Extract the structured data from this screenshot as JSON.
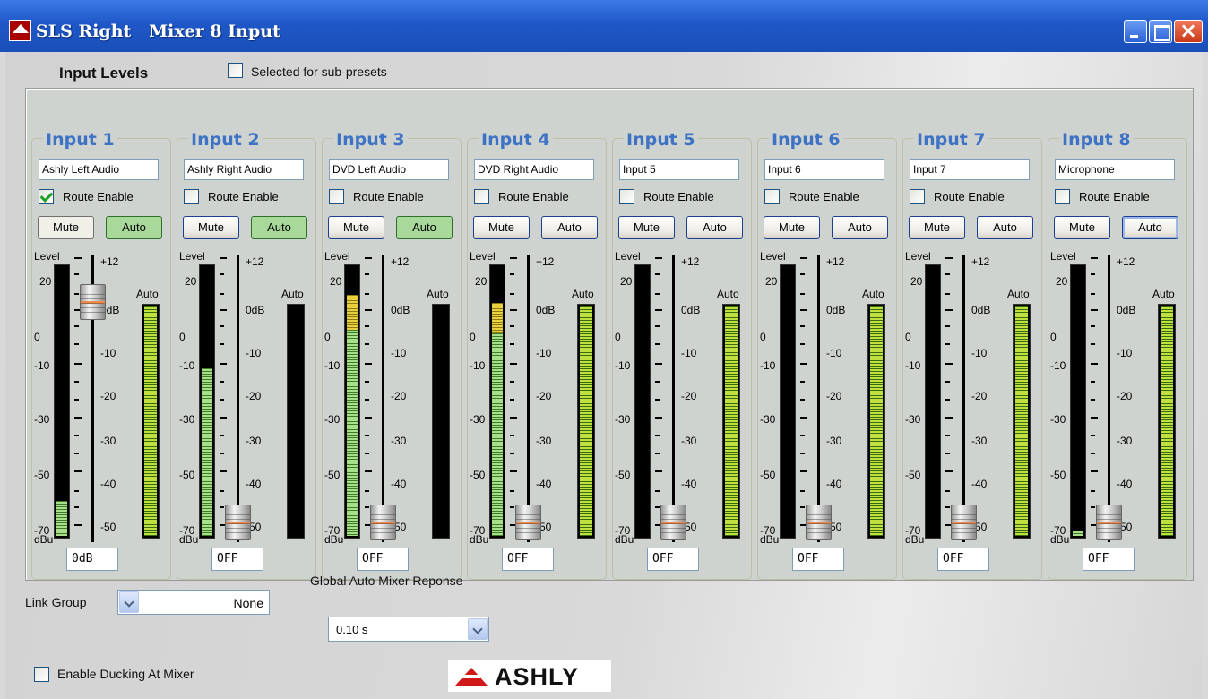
{
  "window": {
    "title": "SLS Right   Mixer 8 Input",
    "icon_text": "ASHLY"
  },
  "header": {
    "section_title": "Input Levels",
    "subpreset_label": "Selected for sub-presets",
    "subpreset_checked": false
  },
  "scale_labels": {
    "level": "Level",
    "dbu": "dBu",
    "meter": [
      "20",
      "0",
      "-10",
      "-30",
      "-50",
      "-70"
    ],
    "fader": [
      "+12",
      "0dB",
      "-10",
      "-20",
      "-30",
      "-40",
      "-50"
    ],
    "auto": "Auto"
  },
  "channels": [
    {
      "title": "Input 1",
      "name": "Ashly Left Audio",
      "route_label": "Route Enable",
      "route": true,
      "mute_label": "Mute",
      "auto_label": "Auto",
      "mute_on": true,
      "auto_on": true,
      "level_db": "0dB",
      "meter_fill": 0.13,
      "meter_yellow": 0,
      "fader_db": 0
    },
    {
      "title": "Input 2",
      "name": "Ashly Right Audio",
      "route_label": "Route Enable",
      "route": false,
      "mute_label": "Mute",
      "auto_label": "Auto",
      "mute_on": false,
      "auto_on": true,
      "level_db": "OFF",
      "meter_fill": 0.62,
      "meter_yellow": 0,
      "fader_db": -50
    },
    {
      "title": "Input 3",
      "name": "DVD Left Audio",
      "route_label": "Route Enable",
      "route": false,
      "mute_label": "Mute",
      "auto_label": "Auto",
      "mute_on": false,
      "auto_on": true,
      "level_db": "OFF",
      "meter_fill": 0.76,
      "meter_yellow": 0.13,
      "fader_db": -50
    },
    {
      "title": "Input 4",
      "name": "DVD Right Audio",
      "route_label": "Route Enable",
      "route": false,
      "mute_label": "Mute",
      "auto_label": "Auto",
      "mute_on": false,
      "auto_on": false,
      "level_db": "OFF",
      "meter_fill": 0.75,
      "meter_yellow": 0.11,
      "fader_db": -50
    },
    {
      "title": "Input 5",
      "name": "Input 5",
      "route_label": "Route Enable",
      "route": false,
      "mute_label": "Mute",
      "auto_label": "Auto",
      "mute_on": false,
      "auto_on": false,
      "level_db": "OFF",
      "meter_fill": 0,
      "meter_yellow": 0,
      "fader_db": -50
    },
    {
      "title": "Input 6",
      "name": "Input 6",
      "route_label": "Route Enable",
      "route": false,
      "mute_label": "Mute",
      "auto_label": "Auto",
      "mute_on": false,
      "auto_on": false,
      "level_db": "OFF",
      "meter_fill": 0,
      "meter_yellow": 0,
      "fader_db": -50
    },
    {
      "title": "Input 7",
      "name": "Input 7",
      "route_label": "Route Enable",
      "route": false,
      "mute_label": "Mute",
      "auto_label": "Auto",
      "mute_on": false,
      "auto_on": false,
      "level_db": "OFF",
      "meter_fill": 0,
      "meter_yellow": 0,
      "fader_db": -50
    },
    {
      "title": "Input 8",
      "name": "Microphone",
      "route_label": "Route Enable",
      "route": false,
      "mute_label": "Mute",
      "auto_label": "Auto",
      "mute_on": false,
      "auto_on": false,
      "level_db": "OFF",
      "meter_fill": 0.02,
      "meter_yellow": 0,
      "fader_db": -50
    }
  ],
  "footer": {
    "link_group_label": "Link Group",
    "link_group_value": "None",
    "gamr_label": "Global Auto Mixer Reponse",
    "gamr_value": "0.10 s",
    "ducking_label": "Enable Ducking At Mixer",
    "ducking_checked": false,
    "logo_text": "ASHLY"
  },
  "colors": {
    "title_bar": "#1f57c8",
    "strip_title": "#3d72c4",
    "auto_on": "#a8d89a",
    "meter_green": "#a8e08a",
    "meter_yellow": "#e8d040",
    "fader_line": "#f08a4a"
  }
}
